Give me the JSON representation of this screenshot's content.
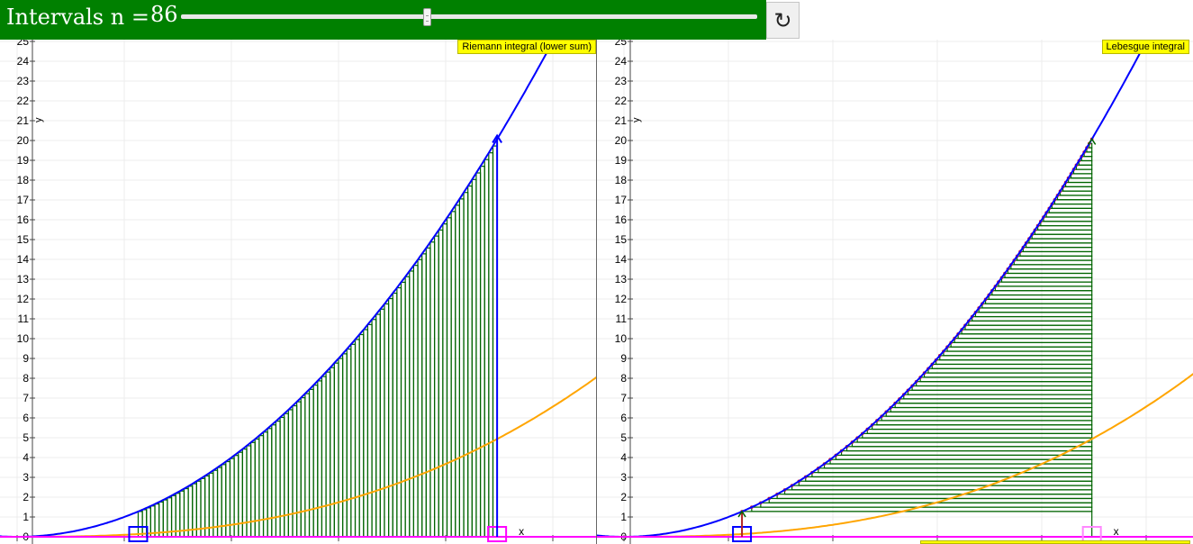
{
  "header": {
    "interval_label": "Intervals n =",
    "interval_value": "86",
    "slider": {
      "min": 1,
      "max": 200,
      "value": 86
    },
    "refresh_icon": "rotate-icon",
    "refresh_glyph": "↻",
    "background_color": "#008000"
  },
  "colors": {
    "function_curve": "#0000ff",
    "derivative_curve": "#ffa500",
    "strips": "#006400",
    "points": "#dc143c",
    "x_axis_line": "#ff00ff",
    "caption_bg": "#ffff00"
  },
  "panels": [
    {
      "caption": "Riemann integral (lower sum)",
      "x_axis_label": "x",
      "y_axis_label": "y",
      "y_tick_labels": [
        "0",
        "1",
        "2",
        "3",
        "4",
        "5",
        "6",
        "7",
        "8",
        "9",
        "10",
        "11",
        "12",
        "13",
        "14",
        "15",
        "16",
        "17",
        "18",
        "19",
        "20",
        "21",
        "22",
        "23",
        "24",
        "25"
      ],
      "sum_type": "vertical-riemann-lower"
    },
    {
      "caption": "Lebesgue integral",
      "x_axis_label": "x",
      "y_axis_label": "y",
      "y_tick_labels": [
        "0",
        "1",
        "2",
        "3",
        "4",
        "5",
        "6",
        "7",
        "8",
        "9",
        "10",
        "11",
        "12",
        "13",
        "14",
        "15",
        "16",
        "17",
        "18",
        "19",
        "20",
        "21",
        "22",
        "23",
        "24",
        "25"
      ],
      "sum_type": "horizontal-lebesgue"
    }
  ]
}
